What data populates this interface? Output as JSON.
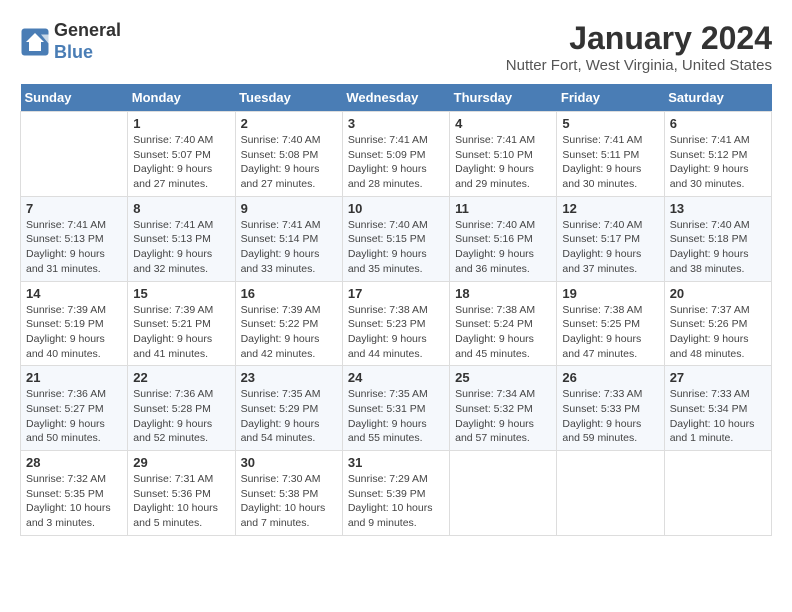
{
  "logo": {
    "line1": "General",
    "line2": "Blue"
  },
  "title": "January 2024",
  "location": "Nutter Fort, West Virginia, United States",
  "days_header": [
    "Sunday",
    "Monday",
    "Tuesday",
    "Wednesday",
    "Thursday",
    "Friday",
    "Saturday"
  ],
  "weeks": [
    [
      {
        "day": "",
        "info": ""
      },
      {
        "day": "1",
        "info": "Sunrise: 7:40 AM\nSunset: 5:07 PM\nDaylight: 9 hours\nand 27 minutes."
      },
      {
        "day": "2",
        "info": "Sunrise: 7:40 AM\nSunset: 5:08 PM\nDaylight: 9 hours\nand 27 minutes."
      },
      {
        "day": "3",
        "info": "Sunrise: 7:41 AM\nSunset: 5:09 PM\nDaylight: 9 hours\nand 28 minutes."
      },
      {
        "day": "4",
        "info": "Sunrise: 7:41 AM\nSunset: 5:10 PM\nDaylight: 9 hours\nand 29 minutes."
      },
      {
        "day": "5",
        "info": "Sunrise: 7:41 AM\nSunset: 5:11 PM\nDaylight: 9 hours\nand 30 minutes."
      },
      {
        "day": "6",
        "info": "Sunrise: 7:41 AM\nSunset: 5:12 PM\nDaylight: 9 hours\nand 30 minutes."
      }
    ],
    [
      {
        "day": "7",
        "info": "Sunrise: 7:41 AM\nSunset: 5:13 PM\nDaylight: 9 hours\nand 31 minutes."
      },
      {
        "day": "8",
        "info": "Sunrise: 7:41 AM\nSunset: 5:13 PM\nDaylight: 9 hours\nand 32 minutes."
      },
      {
        "day": "9",
        "info": "Sunrise: 7:41 AM\nSunset: 5:14 PM\nDaylight: 9 hours\nand 33 minutes."
      },
      {
        "day": "10",
        "info": "Sunrise: 7:40 AM\nSunset: 5:15 PM\nDaylight: 9 hours\nand 35 minutes."
      },
      {
        "day": "11",
        "info": "Sunrise: 7:40 AM\nSunset: 5:16 PM\nDaylight: 9 hours\nand 36 minutes."
      },
      {
        "day": "12",
        "info": "Sunrise: 7:40 AM\nSunset: 5:17 PM\nDaylight: 9 hours\nand 37 minutes."
      },
      {
        "day": "13",
        "info": "Sunrise: 7:40 AM\nSunset: 5:18 PM\nDaylight: 9 hours\nand 38 minutes."
      }
    ],
    [
      {
        "day": "14",
        "info": "Sunrise: 7:39 AM\nSunset: 5:19 PM\nDaylight: 9 hours\nand 40 minutes."
      },
      {
        "day": "15",
        "info": "Sunrise: 7:39 AM\nSunset: 5:21 PM\nDaylight: 9 hours\nand 41 minutes."
      },
      {
        "day": "16",
        "info": "Sunrise: 7:39 AM\nSunset: 5:22 PM\nDaylight: 9 hours\nand 42 minutes."
      },
      {
        "day": "17",
        "info": "Sunrise: 7:38 AM\nSunset: 5:23 PM\nDaylight: 9 hours\nand 44 minutes."
      },
      {
        "day": "18",
        "info": "Sunrise: 7:38 AM\nSunset: 5:24 PM\nDaylight: 9 hours\nand 45 minutes."
      },
      {
        "day": "19",
        "info": "Sunrise: 7:38 AM\nSunset: 5:25 PM\nDaylight: 9 hours\nand 47 minutes."
      },
      {
        "day": "20",
        "info": "Sunrise: 7:37 AM\nSunset: 5:26 PM\nDaylight: 9 hours\nand 48 minutes."
      }
    ],
    [
      {
        "day": "21",
        "info": "Sunrise: 7:36 AM\nSunset: 5:27 PM\nDaylight: 9 hours\nand 50 minutes."
      },
      {
        "day": "22",
        "info": "Sunrise: 7:36 AM\nSunset: 5:28 PM\nDaylight: 9 hours\nand 52 minutes."
      },
      {
        "day": "23",
        "info": "Sunrise: 7:35 AM\nSunset: 5:29 PM\nDaylight: 9 hours\nand 54 minutes."
      },
      {
        "day": "24",
        "info": "Sunrise: 7:35 AM\nSunset: 5:31 PM\nDaylight: 9 hours\nand 55 minutes."
      },
      {
        "day": "25",
        "info": "Sunrise: 7:34 AM\nSunset: 5:32 PM\nDaylight: 9 hours\nand 57 minutes."
      },
      {
        "day": "26",
        "info": "Sunrise: 7:33 AM\nSunset: 5:33 PM\nDaylight: 9 hours\nand 59 minutes."
      },
      {
        "day": "27",
        "info": "Sunrise: 7:33 AM\nSunset: 5:34 PM\nDaylight: 10 hours\nand 1 minute."
      }
    ],
    [
      {
        "day": "28",
        "info": "Sunrise: 7:32 AM\nSunset: 5:35 PM\nDaylight: 10 hours\nand 3 minutes."
      },
      {
        "day": "29",
        "info": "Sunrise: 7:31 AM\nSunset: 5:36 PM\nDaylight: 10 hours\nand 5 minutes."
      },
      {
        "day": "30",
        "info": "Sunrise: 7:30 AM\nSunset: 5:38 PM\nDaylight: 10 hours\nand 7 minutes."
      },
      {
        "day": "31",
        "info": "Sunrise: 7:29 AM\nSunset: 5:39 PM\nDaylight: 10 hours\nand 9 minutes."
      },
      {
        "day": "",
        "info": ""
      },
      {
        "day": "",
        "info": ""
      },
      {
        "day": "",
        "info": ""
      }
    ]
  ]
}
